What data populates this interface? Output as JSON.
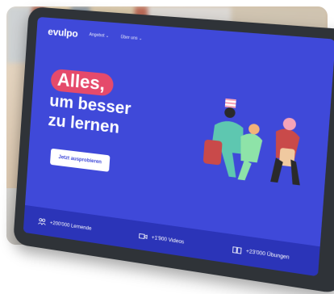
{
  "brand": {
    "name": "evulpo"
  },
  "nav": {
    "items": [
      "Angebot ⌄",
      "Über uns ⌄"
    ]
  },
  "hero": {
    "highlight": "Alles,",
    "line2": "um besser",
    "line3": "zu lernen",
    "cta_label": "Jetzt ausprobieren"
  },
  "stats": [
    {
      "icon": "students-icon",
      "text": "+200'000 Lernende"
    },
    {
      "icon": "video-camera-icon",
      "text": "+1'900 Videos"
    },
    {
      "icon": "book-icon",
      "text": "+23'000 Übungen"
    }
  ],
  "colors": {
    "screen_bg": "#3f49d9",
    "highlight_pill": "#e54a6b",
    "stats_bar": "#2b34b8"
  }
}
